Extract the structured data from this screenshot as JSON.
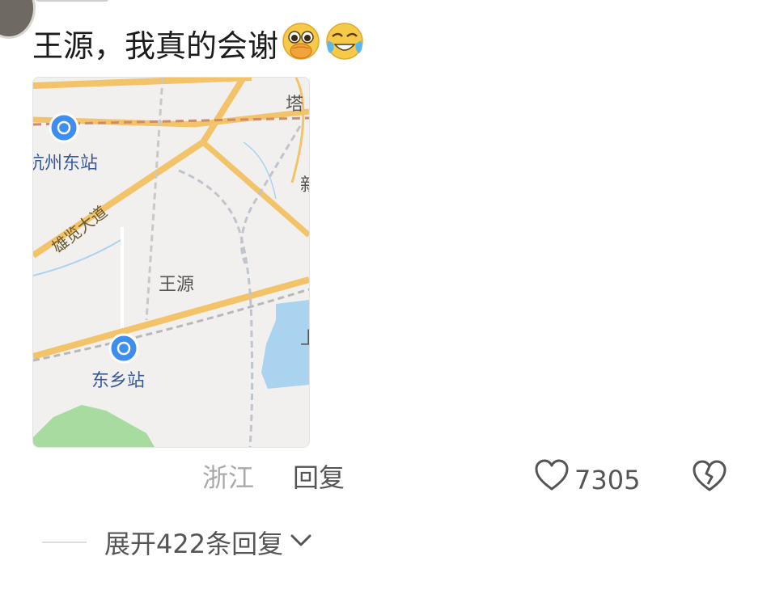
{
  "comment": {
    "text": "王源，我真的会谢",
    "emojis": [
      "pleading-crying-face-emoji",
      "crying-laughing-face-emoji"
    ]
  },
  "map": {
    "labels": {
      "station_top": "杭州东站",
      "road": "雄览大道",
      "area": "王源",
      "station_bottom": "东乡站",
      "edge_top": "塔",
      "edge_right": "新",
      "edge_lake": "上"
    },
    "colors": {
      "road": "#f3c36a",
      "rail": "#d08a6a",
      "water": "#aad3f0",
      "green": "#a8dba0",
      "station": "#3d8ef0"
    }
  },
  "meta": {
    "location": "浙江",
    "reply_label": "回复",
    "like_count": "7305"
  },
  "expand": {
    "label": "展开422条回复"
  }
}
